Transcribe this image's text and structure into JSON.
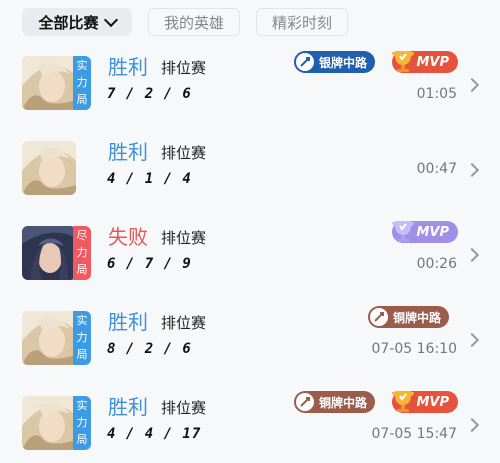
{
  "filters": {
    "all_matches": "全部比赛",
    "my_heroes": "我的英雄",
    "highlights": "精彩时刻"
  },
  "matches": [
    {
      "result": "胜利",
      "type": "排位赛",
      "kda": "7 / 2 / 6",
      "time": "01:05",
      "mode_tag": "实力局",
      "lane_badge": "银牌中路",
      "mvp_badge": "MVP"
    },
    {
      "result": "胜利",
      "type": "排位赛",
      "kda": "4 / 1 / 4",
      "time": "00:47"
    },
    {
      "result": "失败",
      "type": "排位赛",
      "kda": "6 / 7 / 9",
      "time": "00:26",
      "mode_tag": "尽力局",
      "mvp_badge": "MVP"
    },
    {
      "result": "胜利",
      "type": "排位赛",
      "kda": "8 / 2 / 6",
      "time": "07-05 16:10",
      "mode_tag": "实力局",
      "lane_badge": "铜牌中路"
    },
    {
      "result": "胜利",
      "type": "排位赛",
      "kda": "4 / 4 / 17",
      "time": "07-05 15:47",
      "mode_tag": "实力局",
      "lane_badge": "铜牌中路",
      "mvp_badge": "MVP"
    }
  ],
  "colors": {
    "win": "#3f91d8",
    "lose": "#e85659",
    "mode_blue": "#3d9be6",
    "mode_red": "#ee5a5f",
    "silver_badge": "#1f5fae",
    "bronze_badge": "#9c5c4c",
    "mvp_gold": "#e5533c",
    "mvp_purple": "#9f8fe8"
  }
}
